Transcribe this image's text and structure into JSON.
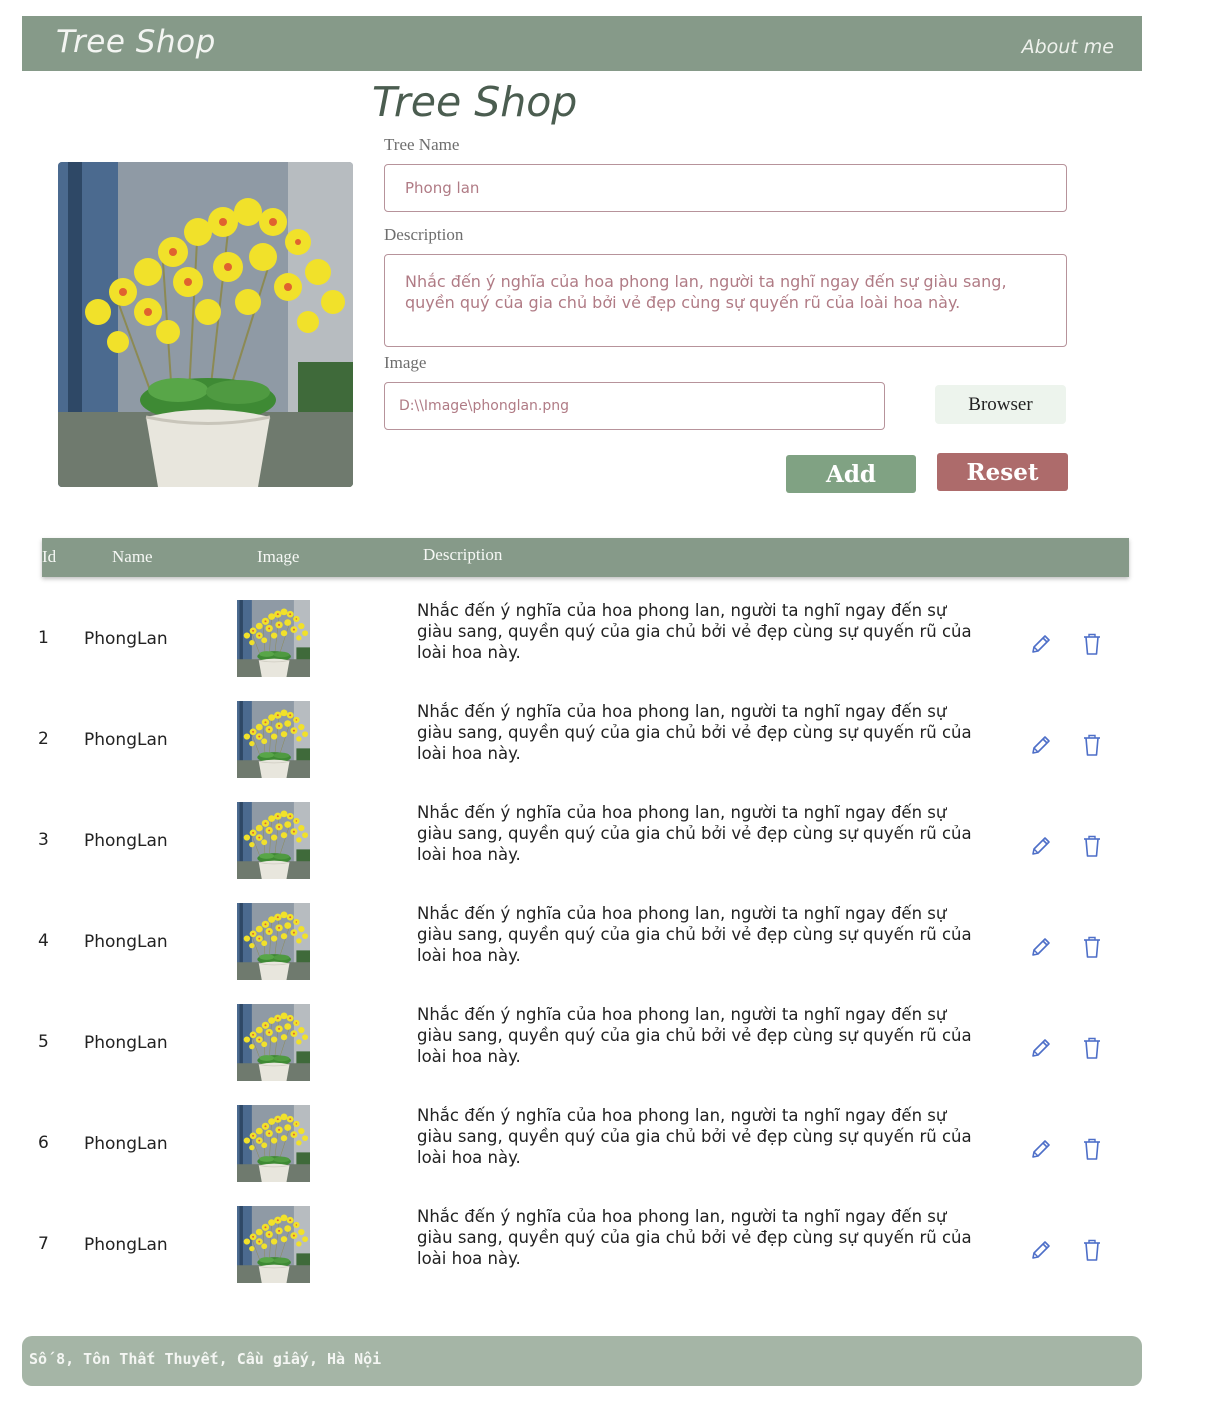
{
  "navbar": {
    "brand": "Tree Shop",
    "about": "About me"
  },
  "form": {
    "title": "Tree Shop",
    "tree_name_label": "Tree Name",
    "tree_name_value": "Phong lan",
    "description_label": "Description",
    "description_value": "Nhắc đến ý nghĩa của hoa phong lan, người ta nghĩ ngay đến sự giàu sang, quyền quý của gia chủ bởi vẻ đẹp cùng sự quyến rũ của loài hoa này.",
    "image_label": "Image",
    "image_value": "D:\\\\Image\\phonglan.png",
    "browse_label": "Browser",
    "add_label": "Add",
    "reset_label": "Reset"
  },
  "table": {
    "headers": {
      "id": "Id",
      "name": "Name",
      "image": "Image",
      "description": "Description"
    },
    "rows": [
      {
        "id": "1",
        "name": "PhongLan",
        "description": "Nhắc đến ý nghĩa của hoa phong lan, người ta nghĩ ngay đến sự giàu sang, quyền quý của gia chủ bởi vẻ đẹp cùng sự quyến rũ của loài hoa này."
      },
      {
        "id": "2",
        "name": "PhongLan",
        "description": "Nhắc đến ý nghĩa của hoa phong lan, người ta nghĩ ngay đến sự giàu sang, quyền quý của gia chủ bởi vẻ đẹp cùng sự quyến rũ của loài hoa này."
      },
      {
        "id": "3",
        "name": "PhongLan",
        "description": "Nhắc đến ý nghĩa của hoa phong lan, người ta nghĩ ngay đến sự giàu sang, quyền quý của gia chủ bởi vẻ đẹp cùng sự quyến rũ của loài hoa này."
      },
      {
        "id": "4",
        "name": "PhongLan",
        "description": "Nhắc đến ý nghĩa của hoa phong lan, người ta nghĩ ngay đến sự giàu sang, quyền quý của gia chủ bởi vẻ đẹp cùng sự quyến rũ của loài hoa này."
      },
      {
        "id": "5",
        "name": "PhongLan",
        "description": "Nhắc đến ý nghĩa của hoa phong lan, người ta nghĩ ngay đến sự giàu sang, quyền quý của gia chủ bởi vẻ đẹp cùng sự quyến rũ của loài hoa này."
      },
      {
        "id": "6",
        "name": "PhongLan",
        "description": "Nhắc đến ý nghĩa của hoa phong lan, người ta nghĩ ngay đến sự giàu sang, quyền quý của gia chủ bởi vẻ đẹp cùng sự quyến rũ của loài hoa này."
      },
      {
        "id": "7",
        "name": "PhongLan",
        "description": "Nhắc đến ý nghĩa của hoa phong lan, người ta nghĩ ngay đến sự giàu sang, quyền quý của gia chủ bởi vẻ đẹp cùng sự quyến rũ của loài hoa này."
      }
    ]
  },
  "icons": {
    "edit": "pencil-icon",
    "delete": "trash-icon"
  },
  "footer": {
    "address": "Số 8, Tôn Thất Thuyết, Cầu giấy, Hà Nội"
  },
  "colors": {
    "navbar": "#869a89",
    "add": "#80a283",
    "reset": "#ad6b6b",
    "browse": "#edf4ed",
    "footer": "#a5b5a6",
    "icon": "#4e6fc8"
  }
}
